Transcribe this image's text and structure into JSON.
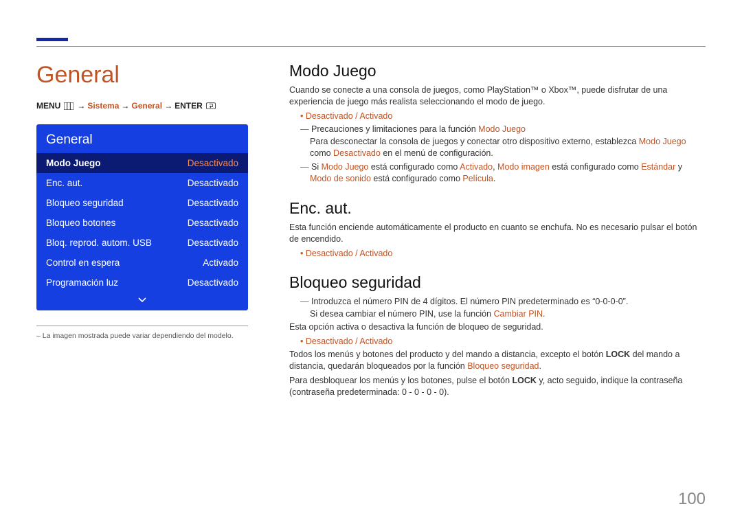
{
  "page_number": "100",
  "left": {
    "title": "General",
    "menu_path": {
      "menu": "MENU",
      "sistema": "Sistema",
      "general": "General",
      "enter": "ENTER"
    },
    "osd": {
      "title": "General",
      "rows": [
        {
          "label": "Modo Juego",
          "value": "Desactivado",
          "selected": true
        },
        {
          "label": "Enc. aut.",
          "value": "Desactivado",
          "selected": false
        },
        {
          "label": "Bloqueo seguridad",
          "value": "Desactivado",
          "selected": false
        },
        {
          "label": "Bloqueo botones",
          "value": "Desactivado",
          "selected": false
        },
        {
          "label": "Bloq. reprod. autom. USB",
          "value": "Desactivado",
          "selected": false
        },
        {
          "label": "Control en espera",
          "value": "Activado",
          "selected": false
        },
        {
          "label": "Programación luz",
          "value": "Desactivado",
          "selected": false
        }
      ]
    },
    "image_note": "– La imagen mostrada puede variar dependiendo del modelo."
  },
  "right": {
    "modo_juego": {
      "h": "Modo Juego",
      "p1": "Cuando se conecte a una consola de juegos, como PlayStation™ o Xbox™, puede disfrutar de una experiencia de juego más realista seleccionando el modo de juego.",
      "opt_off": "Desactivado",
      "opt_sep": " / ",
      "opt_on": "Activado",
      "d1_pre": "Precauciones y limitaciones para la función ",
      "d1_hl": "Modo Juego",
      "d1b_pre": "Para desconectar la consola de juegos y conectar otro dispositivo externo, establezca ",
      "d1b_hl1": "Modo Juego",
      "d1b_mid": " como ",
      "d1b_hl2": "Desactivado",
      "d1b_post": " en el menú de configuración.",
      "d2_a": "Si ",
      "d2_b": "Modo Juego",
      "d2_c": " está configurado como ",
      "d2_d": "Activado",
      "d2_e": ", ",
      "d2_f": "Modo imagen",
      "d2_g": " está configurado como ",
      "d2_h": "Estándar",
      "d2_i": " y ",
      "d2_j": "Modo de sonido",
      "d2_k": " está configurado como ",
      "d2_l": "Película",
      "d2_m": "."
    },
    "enc_aut": {
      "h": "Enc. aut.",
      "p1": "Esta función enciende automáticamente el producto en cuanto se enchufa. No es necesario pulsar el botón de encendido.",
      "opt_off": "Desactivado",
      "opt_sep": " / ",
      "opt_on": "Activado"
    },
    "bloqueo": {
      "h": "Bloqueo seguridad",
      "d1_pre": "Introduzca el número PIN de 4 dígitos. El número PIN predeterminado es “0-0-0-0”.",
      "d1b_pre": "Si desea cambiar el número PIN, use la función ",
      "d1b_hl": "Cambiar PIN",
      "d1b_post": ".",
      "p1": "Esta opción activa o desactiva la función de bloqueo de seguridad.",
      "opt_off": "Desactivado",
      "opt_sep": " / ",
      "opt_on": "Activado",
      "p2_a": "Todos los menús y botones del producto y del mando a distancia, excepto el botón ",
      "p2_b": "LOCK",
      "p2_c": " del mando a distancia, quedarán bloqueados por la función ",
      "p2_d": "Bloqueo seguridad",
      "p2_e": ".",
      "p3_a": "Para desbloquear los menús y los botones, pulse el botón ",
      "p3_b": "LOCK",
      "p3_c": " y, acto seguido, indique la contraseña (contraseña predeterminada: 0 - 0 - 0 - 0)."
    }
  }
}
